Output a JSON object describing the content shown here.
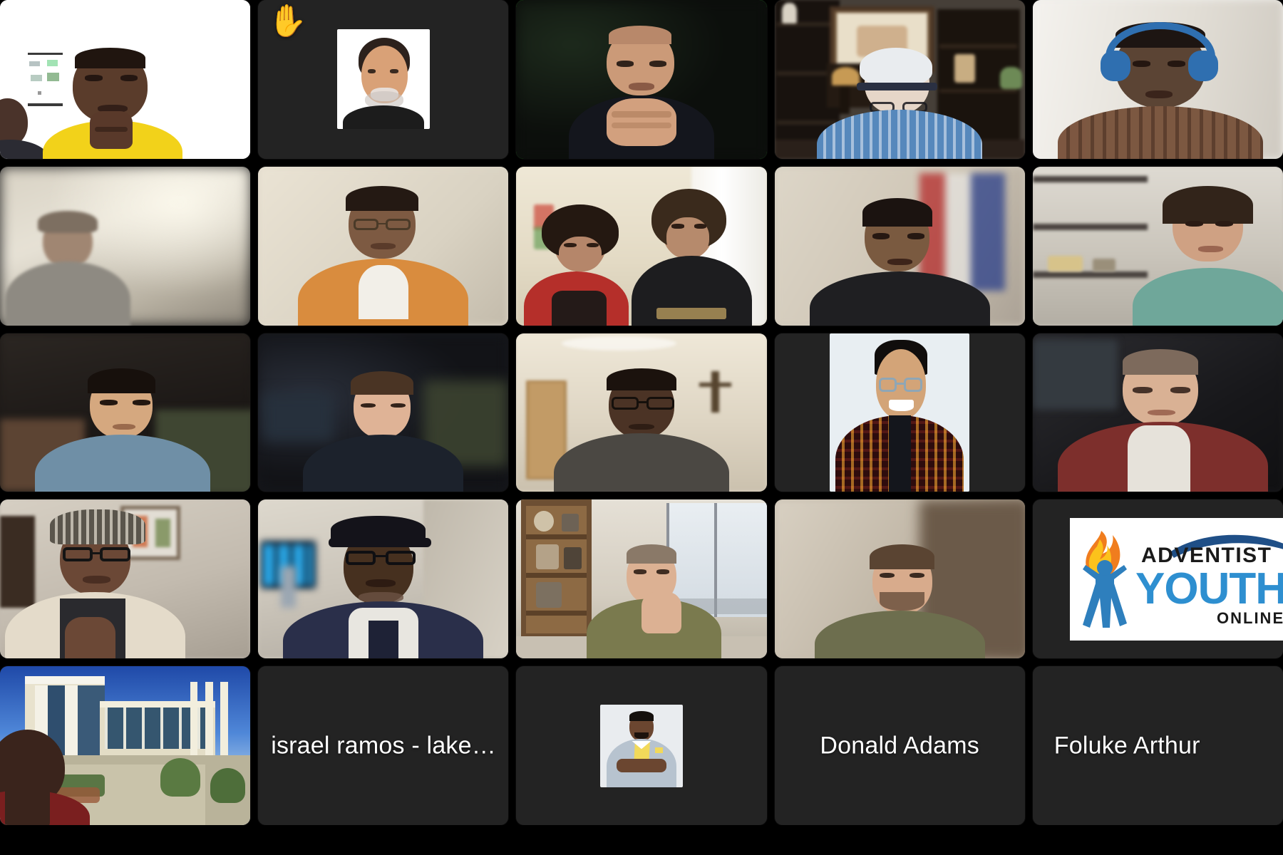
{
  "app": {
    "name": "video-conference-grid",
    "layout": "5x5-tiled-gallery",
    "background_color": "#000000",
    "tile_background_color": "#232323",
    "active_speaker_border_color": "#26e026",
    "name_text_color": "#ffffff"
  },
  "badges": {
    "raised_hand_glyph": "✋",
    "raised_hand_color": "#f5b932"
  },
  "grid": {
    "rows": 5,
    "columns": 5,
    "tiles": [
      {
        "id": "r1c1",
        "kind": "video",
        "description": "man in yellow hoodie on white background with printed chart on wall",
        "name": "",
        "active_speaker": false,
        "raised_hand": false
      },
      {
        "id": "r1c2",
        "kind": "avatar",
        "description": "smiling man with dark hair and grey beard, profile photo on dark tile",
        "name": "",
        "active_speaker": false,
        "raised_hand": true
      },
      {
        "id": "r1c3",
        "kind": "video",
        "description": "bald man with hands clasped, dark room, active speaker",
        "name": "",
        "active_speaker": true,
        "raised_hand": false
      },
      {
        "id": "r1c4",
        "kind": "video",
        "description": "elderly man with white cap and headset, plaid shirt, dark bookshelves and framed picture",
        "name": "",
        "active_speaker": false,
        "raised_hand": false
      },
      {
        "id": "r1c5",
        "kind": "video",
        "description": "man wearing blue over-ear headphones, plaid shirt, bright wall",
        "name": "",
        "active_speaker": false,
        "raised_hand": false
      },
      {
        "id": "r2c1",
        "kind": "video",
        "description": "man in grey sweater and cap, blurred bright living room",
        "name": "",
        "active_speaker": false,
        "raised_hand": false
      },
      {
        "id": "r2c2",
        "kind": "video",
        "description": "woman with glasses in orange top, pale wall",
        "name": "",
        "active_speaker": false,
        "raised_hand": false
      },
      {
        "id": "r2c3",
        "kind": "video",
        "description": "two women side by side, one in red cardigan, one in black take-heart shirt",
        "name": "",
        "active_speaker": false,
        "raised_hand": false
      },
      {
        "id": "r2c4",
        "kind": "video",
        "description": "young man in dark shirt, flag and bright window behind",
        "name": "",
        "active_speaker": false,
        "raised_hand": false
      },
      {
        "id": "r2c5",
        "kind": "video",
        "description": "woman with long dark hair in teal top, shelving unit behind",
        "name": "",
        "active_speaker": false,
        "raised_hand": false
      },
      {
        "id": "r3c1",
        "kind": "video",
        "description": "man in light blue polo seated on couch, dark room",
        "name": "",
        "active_speaker": false,
        "raised_hand": false
      },
      {
        "id": "r3c2",
        "kind": "video",
        "description": "man looking down at desk, dark blurred office with monitor",
        "name": "",
        "active_speaker": false,
        "raised_hand": false
      },
      {
        "id": "r3c3",
        "kind": "video",
        "description": "man with glasses in grey shirt, bright room with wooden door and wall cross",
        "name": "",
        "active_speaker": false,
        "raised_hand": false
      },
      {
        "id": "r3c4",
        "kind": "avatar",
        "description": "smiling young man with glasses in red plaid shirt, studio portrait",
        "name": "",
        "active_speaker": false,
        "raised_hand": false
      },
      {
        "id": "r3c5",
        "kind": "video",
        "description": "older man in dark red sweater looking down, dark room",
        "name": "",
        "active_speaker": false,
        "raised_hand": false
      },
      {
        "id": "r4c1",
        "kind": "video",
        "description": "person in plaid newsboy cap and glasses, cream cardigan, framed art behind",
        "name": "",
        "active_speaker": false,
        "raised_hand": false
      },
      {
        "id": "r4c2",
        "kind": "video",
        "description": "man in black flat cap, glasses, navy jacket, office with blue monitors behind",
        "name": "",
        "active_speaker": false,
        "raised_hand": false
      },
      {
        "id": "r4c3",
        "kind": "video",
        "description": "man in olive sweater, modern office with bookshelf and large windows",
        "name": "",
        "active_speaker": false,
        "raised_hand": false
      },
      {
        "id": "r4c4",
        "kind": "video",
        "description": "bearded man in olive shirt, warm blurred interior",
        "name": "",
        "active_speaker": false,
        "raised_hand": false
      },
      {
        "id": "r4c5",
        "kind": "logo",
        "description": "Adventist Youth Online logo on white card",
        "logo": {
          "line1": "ADVENTIST",
          "line2": "YOUTH",
          "line3": "ONLINE",
          "flame_color": "#f5a623",
          "figure_color": "#2e7fbd",
          "text_color": "#1a3a6b",
          "youth_color": "#2e8fd0"
        },
        "name": "",
        "active_speaker": false,
        "raised_hand": false
      },
      {
        "id": "r5c1",
        "kind": "video",
        "description": "man with campus building virtual background, blue sky",
        "name": "",
        "active_speaker": false,
        "raised_hand": false
      },
      {
        "id": "r5c2",
        "kind": "name-only",
        "description": "dark tile with participant name, left aligned and truncated",
        "name": "israel ramos - lake…",
        "name_align": "left",
        "active_speaker": false,
        "raised_hand": false
      },
      {
        "id": "r5c3",
        "kind": "avatar",
        "description": "man in light grey suit with yellow tie, arms folded, studio portrait",
        "name": "",
        "active_speaker": false,
        "raised_hand": false
      },
      {
        "id": "r5c4",
        "kind": "name-only",
        "description": "dark tile with participant name centered",
        "name": "Donald Adams",
        "name_align": "center",
        "active_speaker": false,
        "raised_hand": false
      },
      {
        "id": "r5c5",
        "kind": "name-only",
        "description": "dark tile with participant name, clipped by right screen edge",
        "name": "Foluke Arthur",
        "name_align": "center",
        "active_speaker": false,
        "raised_hand": false
      }
    ]
  }
}
